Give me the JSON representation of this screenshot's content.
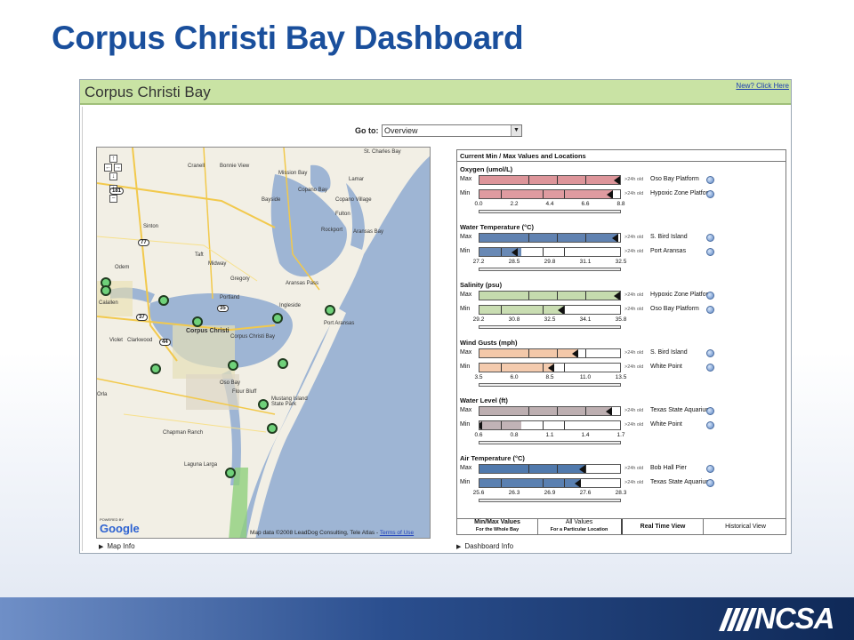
{
  "slide": {
    "title": "Corpus Christi Bay Dashboard",
    "logo": "NCSA"
  },
  "window": {
    "title": "Corpus Christi Bay",
    "top_link": "New? Click Here"
  },
  "goto": {
    "label": "Go to:",
    "selected": "Overview"
  },
  "map": {
    "labels": [
      "St. Charles Bay",
      "Cranell",
      "Bonnie View",
      "Mission Bay",
      "Lamar",
      "Copano Bay",
      "Bayside",
      "Copano Village",
      "Fulton",
      "Sinton",
      "Rockport",
      "Aransas Bay",
      "Taft",
      "Midway",
      "Gregory",
      "Aransas Pass",
      "Odem",
      "Portland",
      "Ingleside",
      "Port Aransas",
      "Calallen",
      "Corpus Christi",
      "Corpus Christi Bay",
      "Violet",
      "Clarkwood",
      "Oso Bay",
      "Flour Bluff",
      "Mustang Island State Park",
      "Chapman Ranch",
      "Laguna Larga",
      "Orla"
    ],
    "highways": [
      "181",
      "77",
      "35",
      "44",
      "37"
    ],
    "credit": "Map data ©2008 LeadDog Consulting, Tele Atlas - ",
    "terms": "Terms of Use",
    "powered_by": "POWERED BY",
    "google": "Google",
    "zoom_controls": [
      "↑",
      "←",
      "→",
      "↓",
      "+",
      "−"
    ],
    "station_count": 14
  },
  "map_info": "Map Info",
  "dashboard_info": "Dashboard Info",
  "panel": {
    "title": "Current Min / Max Values and Locations",
    "metrics": [
      {
        "title": "Oxygen (umol/L)",
        "max_loc": "Oso Bay Platform",
        "min_loc": "Hypoxic Zone Platform",
        "age": ">24h old",
        "ticks": [
          "0.0",
          "2.2",
          "4.4",
          "6.6",
          "8.8"
        ],
        "color": "#d98a8f",
        "max_level": 1.0,
        "min_level": 0.95
      },
      {
        "title": "Water Temperature (°C)",
        "max_loc": "S. Bird Island",
        "min_loc": "Port Aransas",
        "age": ">24h old",
        "ticks": [
          "27.2",
          "28.5",
          "29.8",
          "31.1",
          "32.5"
        ],
        "color": "#4f74a8",
        "max_level": 0.99,
        "min_level": 0.27
      },
      {
        "title": "Salinity (psu)",
        "max_loc": "Hypoxic Zone Platform",
        "min_loc": "Oso Bay Platform",
        "age": ">24h old",
        "ticks": [
          "29.2",
          "30.8",
          "32.5",
          "34.1",
          "35.8"
        ],
        "color": "#bfd7a5",
        "max_level": 1.0,
        "min_level": 0.6
      },
      {
        "title": "Wind Gusts (mph)",
        "max_loc": "S. Bird Island",
        "min_loc": "White Point",
        "age": ">24h old",
        "ticks": [
          "3.5",
          "6.0",
          "8.5",
          "11.0",
          "13.5"
        ],
        "color": "#f2c2a0",
        "max_level": 0.7,
        "min_level": 0.53
      },
      {
        "title": "Water Level (ft)",
        "max_loc": "Texas State Aquarium",
        "min_loc": "White Point",
        "age": ">24h old",
        "ticks": [
          "0.6",
          "0.8",
          "1.1",
          "1.4",
          "1.7"
        ],
        "color": "#b6a6a9",
        "max_level": 0.94,
        "min_level": 0.02
      },
      {
        "title": "Air Temperature (°C)",
        "max_loc": "Bob Hall Pier",
        "min_loc": "Texas State Aquarium",
        "age": ">24h old",
        "ticks": [
          "25.6",
          "26.3",
          "26.9",
          "27.6",
          "28.3"
        ],
        "color": "#3d6aa3",
        "max_level": 0.75,
        "min_level": 0.72
      }
    ],
    "row_max": "Max",
    "row_min": "Min",
    "tabs": [
      {
        "label": "Min/Max Values",
        "sub": "For the Whole Bay"
      },
      {
        "label": "All Values",
        "sub": "For a Particular Location"
      },
      {
        "label": "Real Time View",
        "sub": ""
      },
      {
        "label": "Historical View",
        "sub": ""
      }
    ]
  }
}
